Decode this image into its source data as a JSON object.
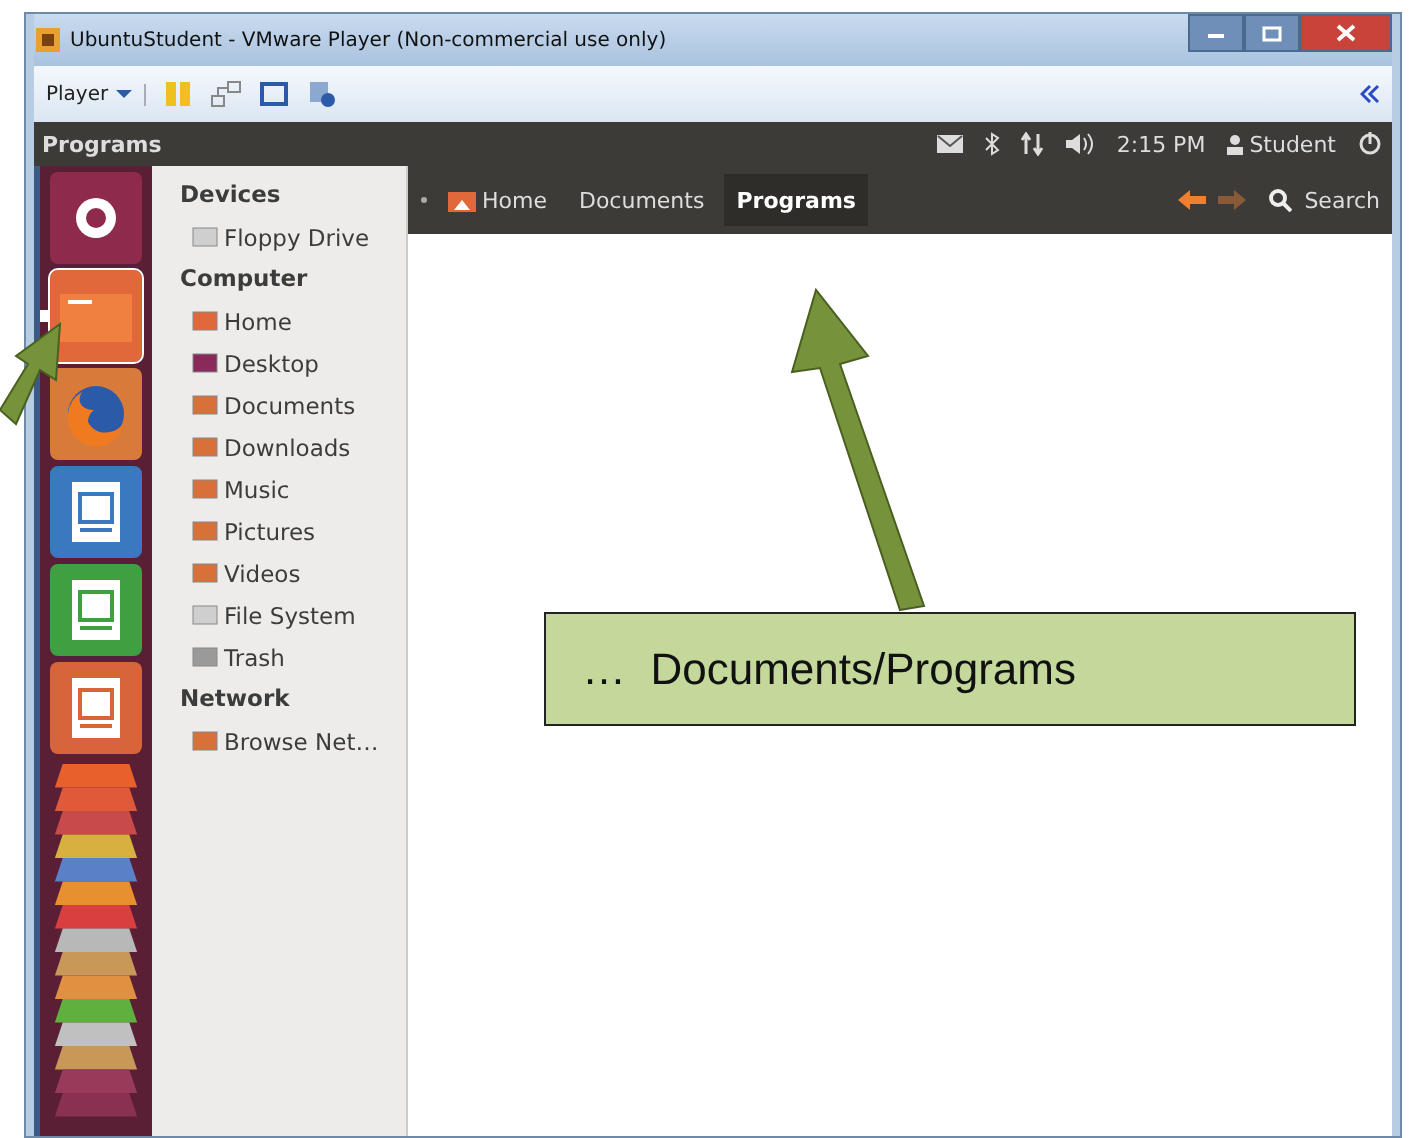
{
  "window": {
    "title": "UbuntuStudent - VMware Player (Non-commercial use only)"
  },
  "player_toolbar": {
    "menu": "Player"
  },
  "panel": {
    "title": "Programs",
    "clock": "2:15 PM",
    "user": "Student"
  },
  "breadcrumbs": [
    {
      "label": "Home",
      "selected": false,
      "kind": "home"
    },
    {
      "label": "Documents",
      "selected": false,
      "kind": "folder"
    },
    {
      "label": "Programs",
      "selected": true,
      "kind": "folder"
    }
  ],
  "search": {
    "label": "Search"
  },
  "launcher": [
    {
      "kind": "ubuntu",
      "selected": false
    },
    {
      "kind": "files",
      "selected": true
    },
    {
      "kind": "firefox",
      "selected": false
    },
    {
      "kind": "writer",
      "selected": false
    },
    {
      "kind": "calc",
      "selected": false
    },
    {
      "kind": "impress",
      "selected": false
    }
  ],
  "sidebar": [
    {
      "heading": "Devices",
      "items": [
        {
          "label": "Floppy Drive",
          "kind": "drive"
        }
      ]
    },
    {
      "heading": "Computer",
      "items": [
        {
          "label": "Home",
          "kind": "home"
        },
        {
          "label": "Desktop",
          "kind": "desktop"
        },
        {
          "label": "Documents",
          "kind": "folder"
        },
        {
          "label": "Downloads",
          "kind": "folder"
        },
        {
          "label": "Music",
          "kind": "folder"
        },
        {
          "label": "Pictures",
          "kind": "folder"
        },
        {
          "label": "Videos",
          "kind": "folder"
        },
        {
          "label": "File System",
          "kind": "drive"
        },
        {
          "label": "Trash",
          "kind": "trash"
        }
      ]
    },
    {
      "heading": "Network",
      "items": [
        {
          "label": "Browse Net…",
          "kind": "folder"
        }
      ]
    }
  ],
  "callout": {
    "text": "…  Documents/Programs"
  }
}
